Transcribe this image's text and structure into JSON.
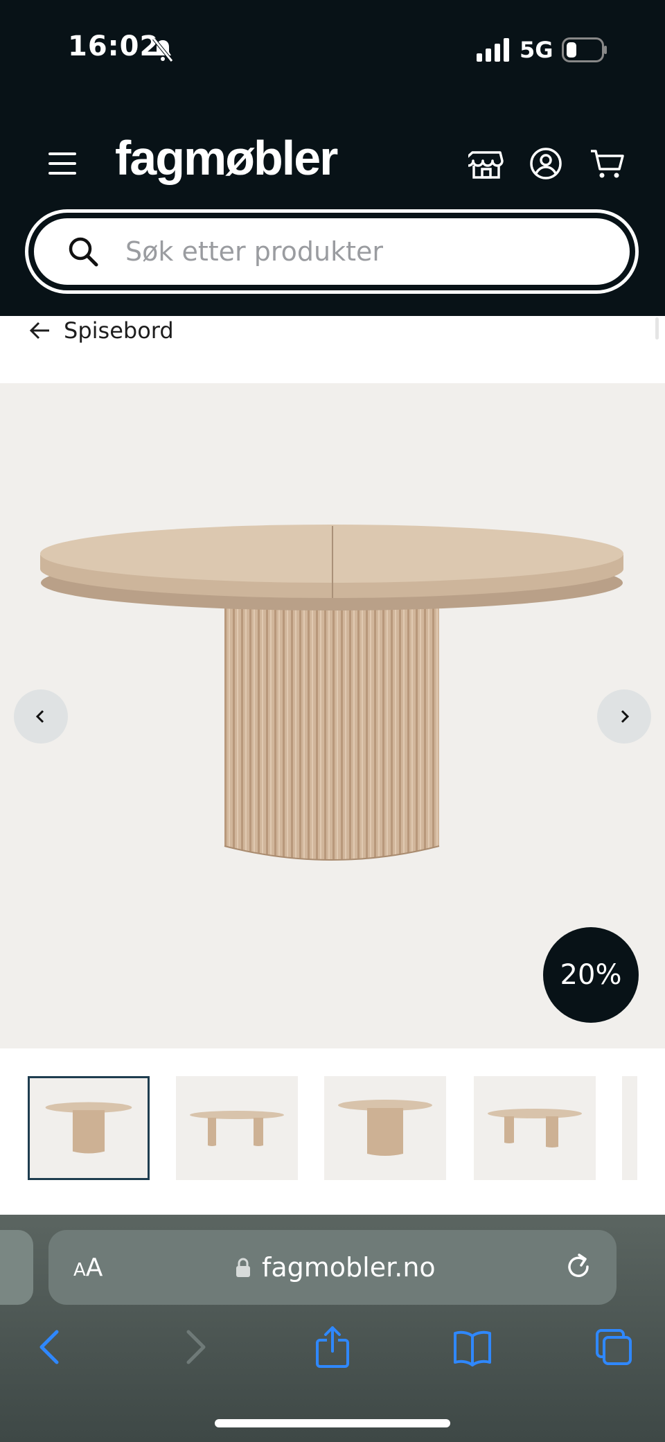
{
  "status_bar": {
    "time": "16:02",
    "network": "5G"
  },
  "header": {
    "logo": "fagmøbler",
    "icons": [
      "menu-icon",
      "store-icon",
      "account-icon",
      "cart-icon"
    ]
  },
  "search": {
    "placeholder": "Søk etter produkter"
  },
  "breadcrumb": {
    "label": "Spisebord"
  },
  "product": {
    "discount": "20%",
    "image_count_visible": 5
  },
  "browser": {
    "text_size_label_small": "A",
    "text_size_label_large": "A",
    "url": "fagmobler.no"
  },
  "colors": {
    "header_bg": "#081217",
    "image_bg": "#f1efec",
    "wood": "#d3bca4",
    "accent_blue": "#1e90ff"
  }
}
